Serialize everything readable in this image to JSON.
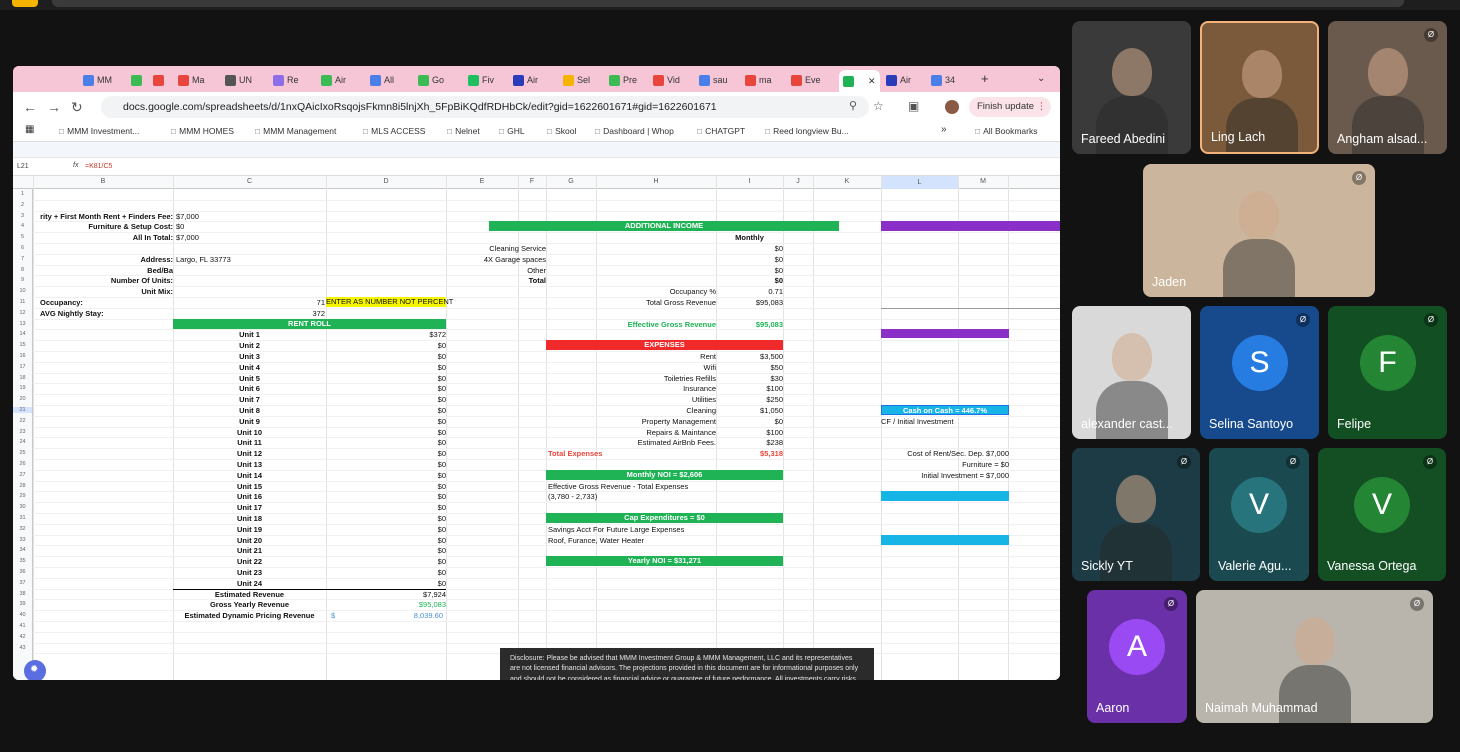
{
  "browser": {
    "tabs": [
      "MM",
      "",
      "",
      "Ma",
      "UN",
      "Re",
      "Air",
      "All",
      "Go",
      "Fiv",
      "Air",
      "Sel",
      "Pre",
      "Vid",
      "sau",
      "ma",
      "Eve",
      "",
      "Air",
      "34"
    ],
    "url": "docs.google.com/spreadsheets/d/1nxQAicIxoRsqojsFkmn8i5lnjXh_5FpBiKQdfRDHbCk/edit?gid=1622601671#gid=1622601671",
    "finish_update": "Finish update",
    "bookmarks": [
      "MMM Investment...",
      "MMM HOMES",
      "MMM Management",
      "MLS ACCESS",
      "Nelnet",
      "GHL",
      "Skool",
      "Dashboard | Whop",
      "CHATGPT",
      "Reed longview Bu..."
    ],
    "all_bookmarks": "All Bookmarks"
  },
  "sheet": {
    "cell_ref": "L21",
    "formula": "=K81/C5",
    "columns": [
      "B",
      "C",
      "D",
      "E",
      "F",
      "G",
      "H",
      "I",
      "J",
      "K",
      "L",
      "M"
    ],
    "rows": [
      "1",
      "2",
      "3",
      "4",
      "5",
      "6",
      "7",
      "8",
      "9",
      "10",
      "11",
      "12",
      "13",
      "14",
      "15",
      "16",
      "17",
      "18",
      "19",
      "20",
      "21",
      "22",
      "23",
      "24",
      "25",
      "26",
      "27",
      "28",
      "29",
      "30",
      "31",
      "32",
      "33",
      "34",
      "35",
      "36",
      "37",
      "38",
      "39",
      "40",
      "41",
      "42",
      "43"
    ],
    "left": {
      "deposit_label": "rity + First Month Rent + Finders Fee:",
      "deposit_val": "$7,000",
      "furn_label": "Furniture & Setup Cost:",
      "furn_val": "$0",
      "allin_label": "All In Total:",
      "allin_val": "$7,000",
      "address_label": "Address:",
      "address_val": "Largo, FL 33773",
      "bedba_label": "Bed/Ba",
      "units_label": "Number Of Units:",
      "mix_label": "Unit Mix:",
      "occ_label": "Occupancy:",
      "occ_val": "71",
      "occ_note": "ENTER AS NUMBER NOT PERCENT",
      "avg_label": "AVG Nightly Stay:",
      "avg_val": "372",
      "rent_roll": "RENT ROLL",
      "units": [
        {
          "n": "Unit 1",
          "v": "$372"
        },
        {
          "n": "Unit 2",
          "v": "$0"
        },
        {
          "n": "Unit 3",
          "v": "$0"
        },
        {
          "n": "Unit 4",
          "v": "$0"
        },
        {
          "n": "Unit 5",
          "v": "$0"
        },
        {
          "n": "Unit 6",
          "v": "$0"
        },
        {
          "n": "Unit 7",
          "v": "$0"
        },
        {
          "n": "Unit 8",
          "v": "$0"
        },
        {
          "n": "Unit 9",
          "v": "$0"
        },
        {
          "n": "Unit 10",
          "v": "$0"
        },
        {
          "n": "Unit 11",
          "v": "$0"
        },
        {
          "n": "Unit 12",
          "v": "$0"
        },
        {
          "n": "Unit 13",
          "v": "$0"
        },
        {
          "n": "Unit 14",
          "v": "$0"
        },
        {
          "n": "Unit 15",
          "v": "$0"
        },
        {
          "n": "Unit 16",
          "v": "$0"
        },
        {
          "n": "Unit 17",
          "v": "$0"
        },
        {
          "n": "Unit 18",
          "v": "$0"
        },
        {
          "n": "Unit 19",
          "v": "$0"
        },
        {
          "n": "Unit 20",
          "v": "$0"
        },
        {
          "n": "Unit 21",
          "v": "$0"
        },
        {
          "n": "Unit 22",
          "v": "$0"
        },
        {
          "n": "Unit 23",
          "v": "$0"
        },
        {
          "n": "Unit 24",
          "v": "$0"
        }
      ],
      "est_rev_label": "Estimated Revenue",
      "est_rev_val": "$7,924",
      "gross_label": "Gross Yearly Revenue",
      "gross_val": "$95,083",
      "dyn_label": "Estimated Dynamic Pricing Revenue",
      "dyn_cur": "$",
      "dyn_val": "8,039.60"
    },
    "middle": {
      "addl_income": "ADDITIONAL INCOME",
      "monthly": "Monthly",
      "income": [
        {
          "n": "Cleaning Service",
          "v": "$0"
        },
        {
          "n": "4X Garage spaces",
          "v": "$0"
        },
        {
          "n": "Other",
          "v": "$0"
        }
      ],
      "total_label": "Total",
      "total_val": "$0",
      "occ_pct_label": "Occupancy %",
      "occ_pct_val": "0.71",
      "tgr_label": "Total Gross Revenue",
      "tgr_val": "$95,083",
      "egr_label": "Effective Gross Revenue",
      "egr_val": "$95,083",
      "expenses": "EXPENSES",
      "exp": [
        {
          "n": "Rent",
          "v": "$3,500"
        },
        {
          "n": "Wifi",
          "v": "$50"
        },
        {
          "n": "Toiletries Refills",
          "v": "$30"
        },
        {
          "n": "Insurance",
          "v": "$100"
        },
        {
          "n": "Utilities",
          "v": "$250"
        },
        {
          "n": "Cleaning",
          "v": "$1,050"
        },
        {
          "n": "Property Management",
          "v": "$0"
        },
        {
          "n": "Repairs & Maintance",
          "v": "$100"
        },
        {
          "n": "Estimated AirBnb Fees.",
          "v": "$238"
        }
      ],
      "tot_exp_label": "Total Expenses",
      "tot_exp_val": "$5,318",
      "mnoi": "Monthly NOI = $2,606",
      "egr_minus": "Effective Gross Revenue - Total Expenses",
      "calc": "(3,780 - 2,733)",
      "capex": "Cap Expenditures = $0",
      "savings": "Savings Acct For Future Large Expenses",
      "roof": "Roof, Furance, Water Heater",
      "ynoi": "Yearly NOI = $31,271"
    },
    "right": {
      "coc": "Cash on Cash = 446.7%",
      "cf": "CF / Initial Investment",
      "cost_rent": "Cost of Rent/Sec. Dep. $7,000",
      "furniture": "Furniture = $0",
      "initial": "Initial Investment = $7,000"
    },
    "disclosure": "Disclosure: Please be advised that MMM Investment Group & MMM Management, LLC and its representatives are not licensed financial advisors. The projections provided in this document are for informational purposes only and should not be considered as financial advice or guarantee of future performance. All investments carry risks, and it is important to do your own research and consult with a qualified financial advisor before making any investment decisions. By considering this opportunity, you acknowledge that MMM Investment Group and its representatives are not liable for any financial losses or decisions made based on the information provided."
  },
  "participants": [
    {
      "name": "Fareed Abedini",
      "kind": "video"
    },
    {
      "name": "Ling Lach",
      "kind": "video"
    },
    {
      "name": "Angham alsad...",
      "kind": "video"
    },
    {
      "name": "Jaden",
      "kind": "video"
    },
    {
      "name": "alexander cast...",
      "kind": "video"
    },
    {
      "name": "Selina Santoyo",
      "initial": "S",
      "color": "#1f63b5"
    },
    {
      "name": "Felipe",
      "initial": "F",
      "color": "#1d6b2a"
    },
    {
      "name": "Sickly YT",
      "kind": "video"
    },
    {
      "name": "Valerie Agu...",
      "initial": "V",
      "color": "#1f5d63"
    },
    {
      "name": "Vanessa Ortega",
      "initial": "V",
      "color": "#1d6b2a"
    },
    {
      "name": "Aaron",
      "initial": "A",
      "color": "#7b3bc2"
    },
    {
      "name": "Naimah Muhammad",
      "kind": "video"
    }
  ],
  "colors": {
    "green_band": "#1fb356",
    "red_band": "#f02a2a",
    "purple_band": "#8b2fc9",
    "cyan_band": "#17b4e6",
    "yellow_note": "#f5f500"
  }
}
